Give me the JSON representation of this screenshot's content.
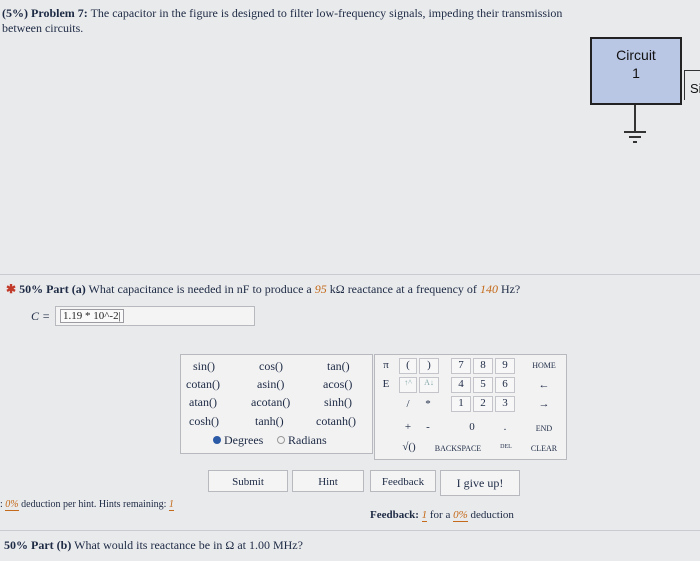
{
  "problem": {
    "prefix": "(5%)",
    "label": "Problem 7:",
    "text": "The capacitor in the figure is designed to filter low-frequency signals, impeding their transmission between circuits."
  },
  "figure": {
    "circuit_title": "Circuit",
    "circuit_number": "1",
    "next_label": "Si"
  },
  "part_a": {
    "percent": "50%",
    "label": "Part (a)",
    "question_before": "What capacitance is needed in nF to produce a",
    "reactance_value": "95",
    "reactance_unit": "kΩ",
    "question_middle": "reactance at a frequency of",
    "frequency_value": "140",
    "frequency_unit": "Hz?",
    "answer_label": "C =",
    "answer_value": "1.19 * 10^-2|"
  },
  "func_keys": {
    "sin": "sin()",
    "cos": "cos()",
    "tan": "tan()",
    "cotan": "cotan()",
    "asin": "asin()",
    "acos": "acos()",
    "atan": "atan()",
    "acotan": "acotan()",
    "sinh": "sinh()",
    "cosh": "cosh()",
    "tanh": "tanh()",
    "cotanh": "cotanh()",
    "degrees": "Degrees",
    "radians": "Radians"
  },
  "num_keys": {
    "pi": "π",
    "lparen": "(",
    "rparen": ")",
    "seven": "7",
    "eight": "8",
    "nine": "9",
    "home": "HOME",
    "e": "E",
    "up": "↑^",
    "down": "A↓",
    "four": "4",
    "five": "5",
    "six": "6",
    "left": "←",
    "divide": "/",
    "multiply": "*",
    "one": "1",
    "two": "2",
    "three": "3",
    "right": "→",
    "plus": "+",
    "minus": "-",
    "zero": "0",
    "dot": ".",
    "end": "END",
    "sqrt": "√()",
    "backspace": "BACKSPACE",
    "del": "DEL",
    "clear": "CLEAR"
  },
  "buttons": {
    "submit": "Submit",
    "hint": "Hint",
    "feedback": "Feedback",
    "give_up": "I give up!"
  },
  "hints": {
    "prefix": ":",
    "deduction": "0%",
    "text": "deduction per hint. Hints remaining:",
    "remaining": "1"
  },
  "feedback": {
    "label": "Feedback:",
    "count": "1",
    "text_for": "for a",
    "deduction": "0%",
    "text_deduction": "deduction"
  },
  "part_b": {
    "percent": "50%",
    "label": "Part (b)",
    "question": "What would its reactance be in Ω at 1.00 MHz?"
  }
}
